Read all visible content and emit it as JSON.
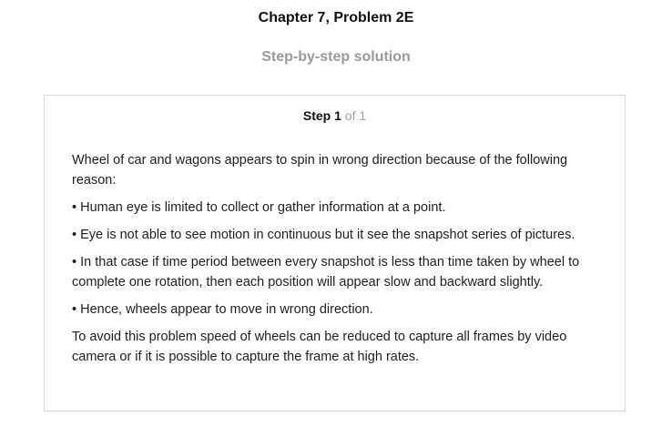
{
  "header": {
    "title": "Chapter 7, Problem 2E",
    "subtitle": "Step-by-step solution"
  },
  "step": {
    "label": "Step",
    "number": "1",
    "of_text": "of 1"
  },
  "solution": {
    "paragraphs": [
      "Wheel of car and wagons appears to spin in wrong direction because of the following reason:",
      "• Human eye is limited to collect or gather information at a point.",
      "• Eye is not able to see motion in continuous but it see the snapshot series of pictures.",
      "• In that case if time period between every snapshot is less than time taken by wheel to complete one rotation, then each position will appear slow and backward slightly.",
      "• Hence, wheels appear to move in wrong direction.",
      "To avoid this problem speed of wheels can be reduced to capture all frames by video camera or if it is possible to capture the frame at high rates."
    ]
  }
}
